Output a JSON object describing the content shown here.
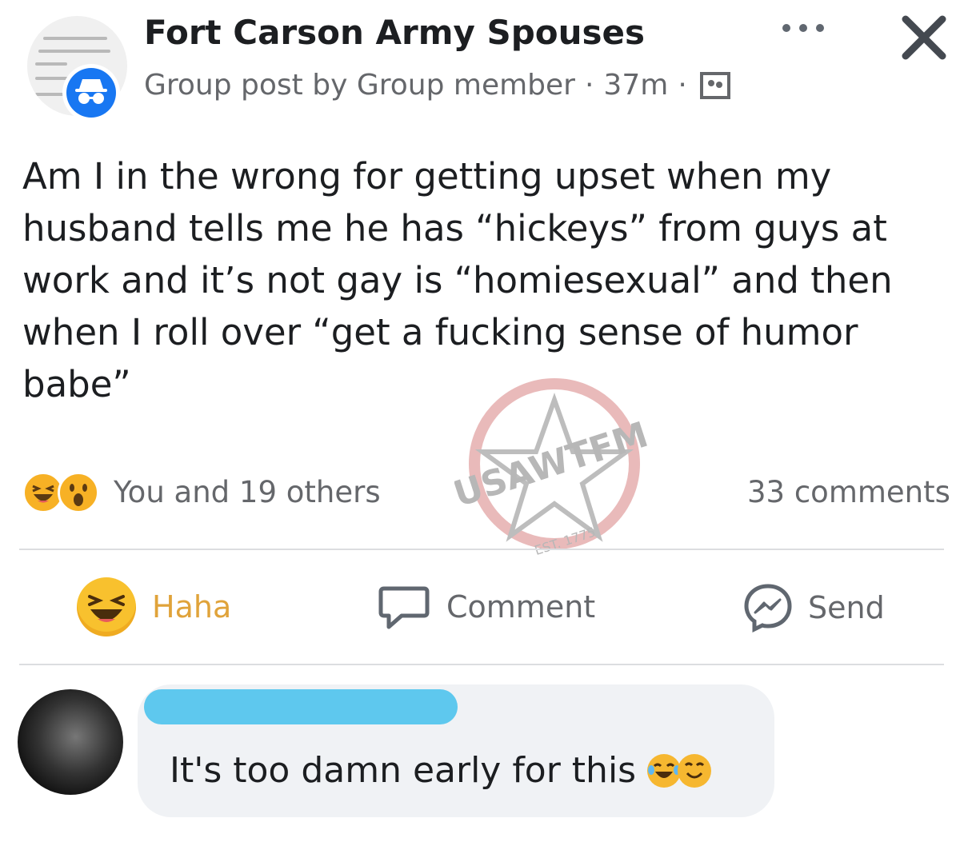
{
  "header": {
    "group_name": "Fort Carson Army Spouses",
    "post_type": "Group post by Group member",
    "time": "37m",
    "separator": "·"
  },
  "post": {
    "text": "Am I in the wrong for getting upset when my husband tells me he has “hickeys” from guys at work and it’s not gay is “homiesexual” and then when I roll over “get a fucking sense of humor babe”"
  },
  "stats": {
    "reactions_label": "You and 19 others",
    "comments_label": "33 comments",
    "reaction_icons": [
      "haha-icon",
      "wow-icon"
    ]
  },
  "actions": {
    "haha_label": "Haha",
    "comment_label": "Comment",
    "send_label": "Send"
  },
  "comment": {
    "text": "It's too damn early for this",
    "redaction_color": "#5ec8ee"
  },
  "watermark": {
    "brand": "USAWTFM",
    "est": "EST. 1775"
  },
  "colors": {
    "accent": "#1877f2",
    "haha": "#e0a33a",
    "text_secondary": "#65676b"
  }
}
